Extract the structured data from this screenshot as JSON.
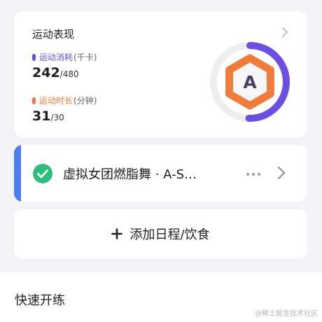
{
  "performance": {
    "title": "运动表现",
    "calories": {
      "label": "运动消耗",
      "unit": "(千卡)",
      "value": "242",
      "total": "/480",
      "progress": 0.504
    },
    "duration": {
      "label": "运动时长",
      "unit": "(分钟)",
      "value": "31",
      "total": "/30",
      "progress": 1.0
    },
    "grade": "A",
    "colors": {
      "calories": "#6c4fe0",
      "duration": "#ee7c3a",
      "track": "#ededed"
    }
  },
  "course": {
    "title": "虚拟女团燃脂舞 · A-S…",
    "status_color": "#2fbd7d",
    "accent_color": "#4e7cf2"
  },
  "add_schedule": {
    "label": "添加日程/饮食"
  },
  "quick_start": {
    "title": "快速开练"
  },
  "watermark": "@稀土掘金技术社区"
}
